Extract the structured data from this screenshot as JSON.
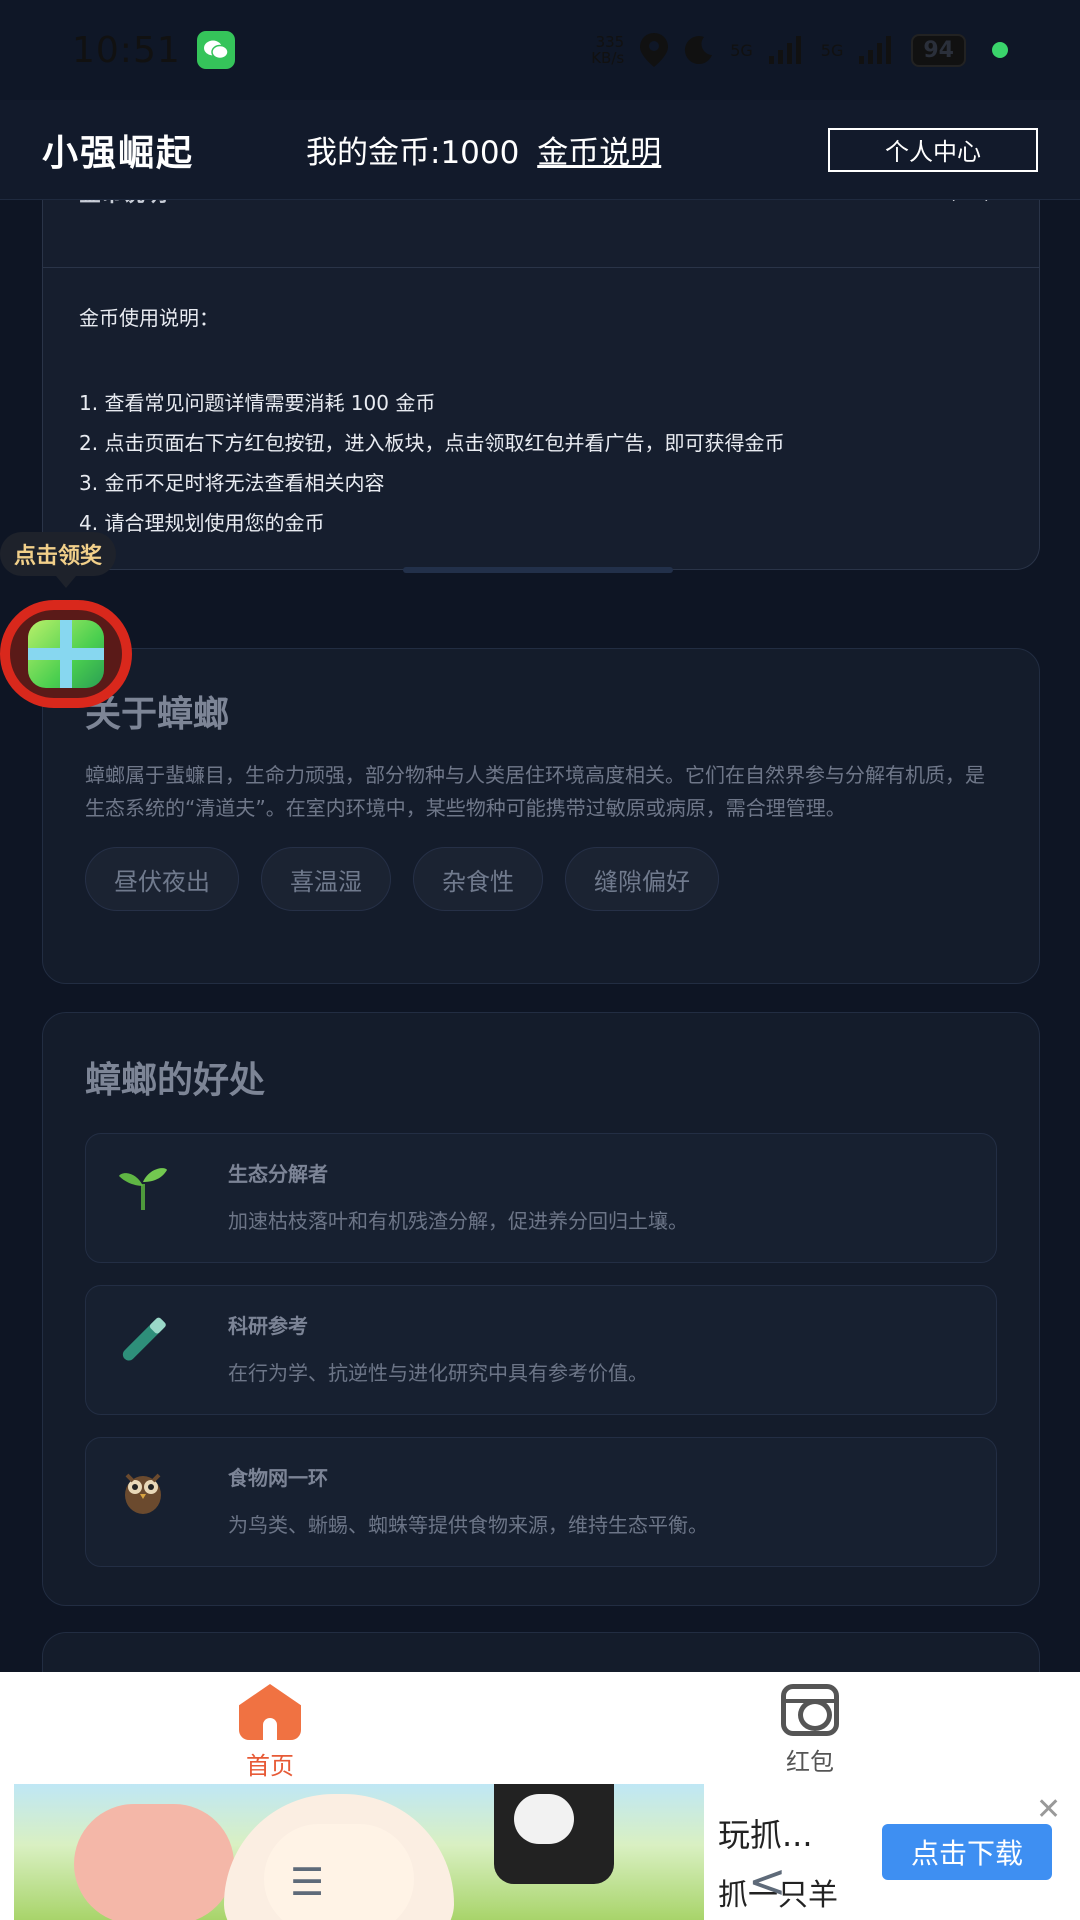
{
  "status_bar": {
    "time": "10:51",
    "net_speed_value": "335",
    "net_speed_unit": "KB/s",
    "signal_1": "5G",
    "signal_2": "5G",
    "battery": "94"
  },
  "header": {
    "brand": "小强崛起",
    "coins_label": "我的金币:1000",
    "coins_link": "金币说明",
    "profile_button": "个人中心"
  },
  "coin_panel": {
    "title": "金币说明",
    "intro": "金币使用说明：",
    "lines": [
      "1. 查看常见问题详情需要消耗 100 金币",
      "2. 点击页面右下方红包按钮，进入板块，点击领取红包并看广告，即可获得金币",
      "3. 金币不足时将无法查看相关内容",
      "4. 请合理规划使用您的金币"
    ]
  },
  "reward": {
    "tooltip": "点击领奖"
  },
  "about": {
    "title": "关于蟑螂",
    "text": "蟑螂属于蜚蠊目，生命力顽强，部分物种与人类居住环境高度相关。它们在自然界参与分解有机质，是生态系统的“清道夫”。在室内环境中，某些物种可能携带过敏原或病原，需合理管理。",
    "tags": [
      "昼伏夜出",
      "喜温湿",
      "杂食性",
      "缝隙偏好"
    ]
  },
  "benefits": {
    "title": "蟑螂的好处",
    "items": [
      {
        "icon": "seedling-icon",
        "title": "生态分解者",
        "desc": "加速枯枝落叶和有机残渣分解，促进养分回归土壤。"
      },
      {
        "icon": "test-tube-icon",
        "title": "科研参考",
        "desc": "在行为学、抗逆性与进化研究中具有参考价值。"
      },
      {
        "icon": "owl-icon",
        "title": "食物网一环",
        "desc": "为鸟类、蜥蜴、蜘蛛等提供食物来源，维持生态平衡。"
      }
    ]
  },
  "bottom_nav": {
    "home": "首页",
    "red_packet": "红包"
  },
  "ad": {
    "title": "玩抓...",
    "subtitle": "抓一只羊",
    "button": "点击下载"
  },
  "colors": {
    "background": "#0e1524",
    "accent_orange": "#e75a36",
    "download_blue": "#3e8ff2",
    "reward_red": "#d9281c"
  }
}
